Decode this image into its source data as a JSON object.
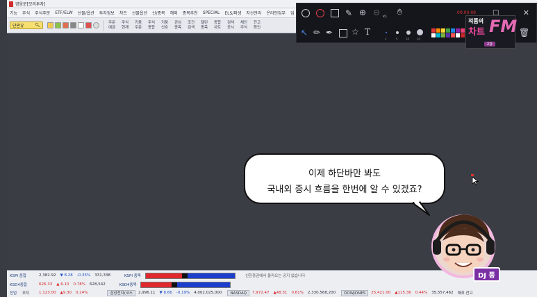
{
  "window": {
    "title": "영웅문[모의투자]"
  },
  "menu": [
    "기능",
    "주식",
    "주식주문",
    "ETF/ELW",
    "선물/옵션",
    "투자정보",
    "차트",
    "선물옵션",
    "신/종목",
    "해외",
    "종목추천",
    "SPECIAL",
    "ELS/파생",
    "자산관리",
    "온라인업무",
    "업"
  ],
  "toolbar": {
    "account_combo": "단판유",
    "buttons": [
      {
        "l1": "주문",
        "l2": "예금"
      },
      {
        "l1": "주식",
        "l2": "현재"
      },
      {
        "l1": "키움",
        "l2": "주문"
      },
      {
        "l1": "주식",
        "l2": "종합"
      },
      {
        "l1": "키움",
        "l2": "신호"
      },
      {
        "l1": "관심",
        "l2": "종목"
      },
      {
        "l1": "조건",
        "l2": "검색"
      },
      {
        "l1": "캘린",
        "l2": "종목"
      },
      {
        "l1": "종합",
        "l2": "차트"
      },
      {
        "l1": "검색",
        "l2": "공시"
      },
      {
        "l1": "체인",
        "l2": "주식"
      },
      {
        "l1": "잔고",
        "l2": "확인"
      }
    ]
  },
  "annotation_tools": {
    "record_label": "00:00:09",
    "zoom_suffix": "x1",
    "stroke_sizes": [
      "2",
      "5",
      "10",
      "20"
    ],
    "swatches": [
      "#e53935",
      "#fb8c00",
      "#fdd835",
      "#43a047",
      "#1e88e5",
      "#8e24aa",
      "#ec407a",
      "#ffffff",
      "#00bcd4",
      "#7cb342",
      "#5e35b1",
      "#ff5252",
      "#ffffff",
      "#c62828"
    ]
  },
  "badge": {
    "line1": "적품의",
    "line2": "차트",
    "brand": "FM",
    "sub": "2강"
  },
  "bubble": {
    "line1": "이제 하단바만 봐도",
    "line2": "국내외 증시 흐름을 한번에 알 수 있겠죠?"
  },
  "dj": {
    "label": "DJ 풍"
  },
  "ticker": {
    "row1": {
      "label": "KSPI 종합",
      "value": "2,382.92",
      "change": "▼ 8.28",
      "pct": "-0.35%",
      "volume": "331,338",
      "label2": "KSPI 종목",
      "message": "신한증권에서 올라오는 공지 없습니다"
    },
    "row2": {
      "label": "KSD4종합",
      "value": "626.33",
      "change": "▲ 6.10",
      "pct": "0.78%",
      "volume": "628,542",
      "label2": "KSD4종목"
    },
    "row3": {
      "label": "전업",
      "name": "무지",
      "v1": "1,123.00",
      "c1": "▲9.30",
      "p1": "0.24%",
      "label2": "삼성전자(코스",
      "v2": "2,996.11",
      "c2": "▼ 8.66",
      "p2": "-0.19%",
      "vol2": "4,002,025,000",
      "nasdaq_label": "NASDAQ",
      "v3": "7,972.47",
      "c3": "▲48.31",
      "p3": "0.61%",
      "vol3": "2,330,568,200",
      "dow_label": "DOWJONES",
      "v4": "25,421.00",
      "c4": "▲115.36",
      "p4": "0.44%",
      "vol4": "35,557,462",
      "tail": "매후 잔고"
    },
    "colors": {
      "up": "#d8262a",
      "down": "#1d4fc7"
    }
  }
}
